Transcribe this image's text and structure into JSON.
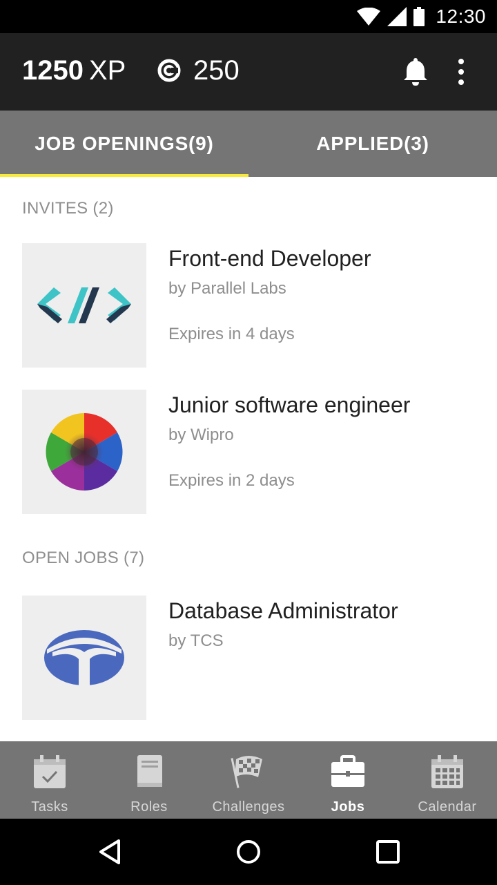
{
  "status_bar": {
    "time": "12:30",
    "icons": [
      "wifi-icon",
      "signal-icon",
      "battery-icon"
    ]
  },
  "header": {
    "xp_value": "1250",
    "xp_unit": "XP",
    "coins": "250",
    "icons": [
      "coin-icon",
      "bell-icon",
      "more-vert-icon"
    ]
  },
  "tabs": [
    {
      "label": "JOB OPENINGS(9)",
      "active": true
    },
    {
      "label": "APPLIED(3)",
      "active": false
    }
  ],
  "sections": {
    "invites": {
      "label": "INVITES (2)"
    },
    "open_jobs": {
      "label": "OPEN JOBS (7)"
    }
  },
  "jobs": [
    {
      "title": "Front-end Developer",
      "company": "by Parallel Labs",
      "expiry": "Expires in 4 days",
      "logo": "code-icon"
    },
    {
      "title": "Junior software engineer",
      "company": "by Wipro",
      "expiry": "Expires in 2 days",
      "logo": "wipro-logo"
    },
    {
      "title": "Database Administrator",
      "company": "by TCS",
      "expiry": "",
      "logo": "tata-logo"
    }
  ],
  "bottom_nav": [
    {
      "label": "Tasks",
      "icon": "calendar-check-icon",
      "active": false
    },
    {
      "label": "Roles",
      "icon": "book-icon",
      "active": false
    },
    {
      "label": "Challenges",
      "icon": "checkered-flag-icon",
      "active": false
    },
    {
      "label": "Jobs",
      "icon": "briefcase-icon",
      "active": true
    },
    {
      "label": "Calendar",
      "icon": "calendar-grid-icon",
      "active": false
    }
  ],
  "colors": {
    "app_bar": "#212121",
    "tabs_bg": "#757575",
    "tab_indicator": "#f7ea3b",
    "logo_bg": "#eeeeee",
    "code_teal": "#3ec3c7",
    "code_navy": "#23374f",
    "tata_blue": "#4a69be"
  }
}
